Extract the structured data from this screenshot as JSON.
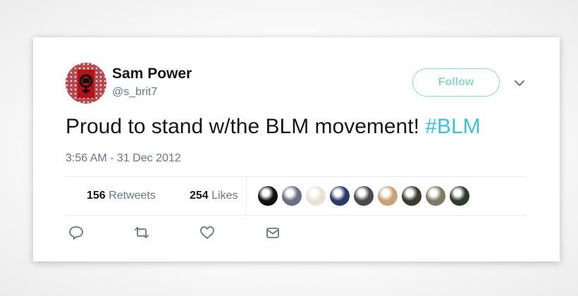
{
  "user": {
    "name": "Sam Power",
    "handle": "@s_brit7"
  },
  "follow_label": "Follow",
  "tweet": {
    "text": "Proud to stand w/the BLM movement! ",
    "hashtag": "#BLM"
  },
  "timestamp": "3:56 AM - 31 Dec 2012",
  "stats": {
    "retweets_count": "156",
    "retweets_label": "Retweets",
    "likes_count": "254",
    "likes_label": "Likes"
  },
  "colors": {
    "accent": "#8fd8c6",
    "hashtag": "#3ec1d3",
    "text": "#14171a",
    "muted": "#657786"
  },
  "likers": [
    {
      "icon": "avatar-1",
      "color": "#111111"
    },
    {
      "icon": "avatar-2",
      "color": "#6b6f80"
    },
    {
      "icon": "avatar-3",
      "color": "#e9e1d4"
    },
    {
      "icon": "avatar-4",
      "color": "#2a3a6a"
    },
    {
      "icon": "avatar-5",
      "color": "#4a4a4a"
    },
    {
      "icon": "avatar-6",
      "color": "#c9a27a"
    },
    {
      "icon": "avatar-7",
      "color": "#3b3a2e"
    },
    {
      "icon": "avatar-8",
      "color": "#7d7a66"
    },
    {
      "icon": "avatar-9",
      "color": "#2f3b2c"
    }
  ],
  "actions": [
    "reply-icon",
    "retweet-icon",
    "like-icon",
    "message-icon"
  ]
}
